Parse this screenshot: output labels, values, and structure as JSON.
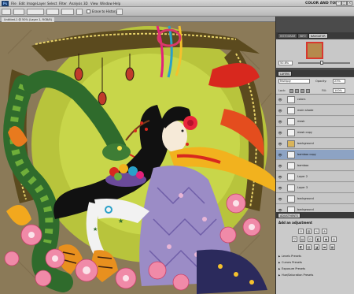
{
  "menubar": {
    "app_badge": "Ps",
    "items": [
      "File",
      "Edit",
      "Image",
      "Layer",
      "Select",
      "Filter",
      "Analysis",
      "3D",
      "View",
      "Window",
      "Help"
    ],
    "workspace_label": "COLOR AND TONE"
  },
  "options": {
    "erase_to_history_label": "Erase to History"
  },
  "document": {
    "tab_label": "Untitled-1 @ 50% (Layer 1, RGB/8)"
  },
  "navigator": {
    "tabs": [
      "HISTOGRAM",
      "INFO",
      "NAVIGATOR"
    ],
    "active_tab": "NAVIGATOR",
    "zoom": "50.6%"
  },
  "layers": {
    "tabs": [
      "LAYERS"
    ],
    "blend_mode": "Multiply",
    "opacity_label": "Opacity:",
    "opacity_value": "23%",
    "lock_label": "Lock:",
    "fill_label": "Fill:",
    "fill_value": "100%",
    "rows": [
      {
        "name": "colors",
        "visible": true,
        "group": false,
        "selected": false
      },
      {
        "name": "main shade",
        "visible": true,
        "group": false,
        "selected": false
      },
      {
        "name": "mask",
        "visible": true,
        "group": false,
        "selected": false
      },
      {
        "name": "mask copy",
        "visible": true,
        "group": false,
        "selected": false
      },
      {
        "name": "background",
        "visible": true,
        "group": true,
        "selected": false
      },
      {
        "name": "bamboo copy",
        "visible": true,
        "group": false,
        "selected": true
      },
      {
        "name": "bamboo",
        "visible": true,
        "group": false,
        "selected": false
      },
      {
        "name": "Layer 2",
        "visible": true,
        "group": false,
        "selected": false
      },
      {
        "name": "Layer 3",
        "visible": true,
        "group": false,
        "selected": false
      },
      {
        "name": "background",
        "visible": true,
        "group": false,
        "selected": false
      },
      {
        "name": "background",
        "visible": true,
        "group": false,
        "selected": false
      }
    ]
  },
  "adjustments": {
    "tab_label": "ADJUSTMENTS",
    "title": "Add an adjustment",
    "presets": [
      "Levels Presets",
      "Curves Presets",
      "Exposure Presets",
      "Hue/Saturation Presets"
    ]
  },
  "colors": {
    "canvas_bg": "#8b7a58",
    "snake_green": "#2f6b2c",
    "flower_pink": "#f08aa8",
    "kimono_purple": "#9b8cc6",
    "scarf_yellow": "#f2b21e",
    "sun_green": "#c8d64a",
    "selected_layer": "#8da3c4"
  }
}
